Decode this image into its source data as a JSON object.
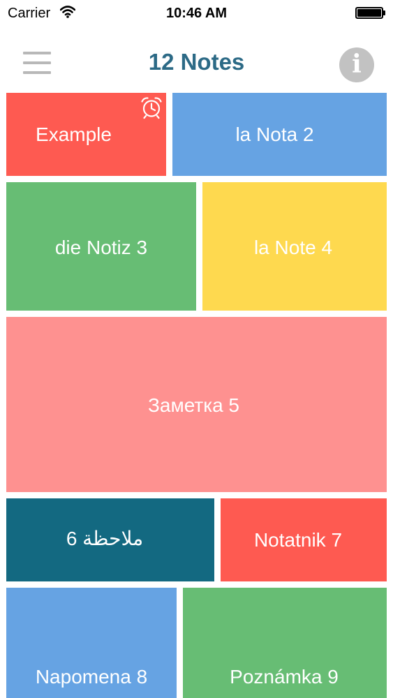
{
  "status_bar": {
    "carrier": "Carrier",
    "time": "10:46 AM"
  },
  "nav": {
    "title": "12 Notes",
    "menu_icon": "hamburger-menu-icon",
    "info_icon": "info-icon"
  },
  "notes": [
    {
      "title": "Example",
      "color": "#fe5a51",
      "has_alarm": true
    },
    {
      "title": "la Nota 2",
      "color": "#66a3e3",
      "has_alarm": false
    },
    {
      "title": "die Notiz 3",
      "color": "#67bd74",
      "has_alarm": false
    },
    {
      "title": "la Note 4",
      "color": "#fed94f",
      "has_alarm": false
    },
    {
      "title": "Заметка 5",
      "color": "#fe9190",
      "has_alarm": false
    },
    {
      "title": "ملاحظة 6",
      "color": "#136981",
      "has_alarm": false
    },
    {
      "title": "Notatnik 7",
      "color": "#fe5a51",
      "has_alarm": false
    },
    {
      "title": "Napomena 8",
      "color": "#66a3e3",
      "has_alarm": false
    },
    {
      "title": "Poznámka 9",
      "color": "#67bd74",
      "has_alarm": false
    }
  ]
}
